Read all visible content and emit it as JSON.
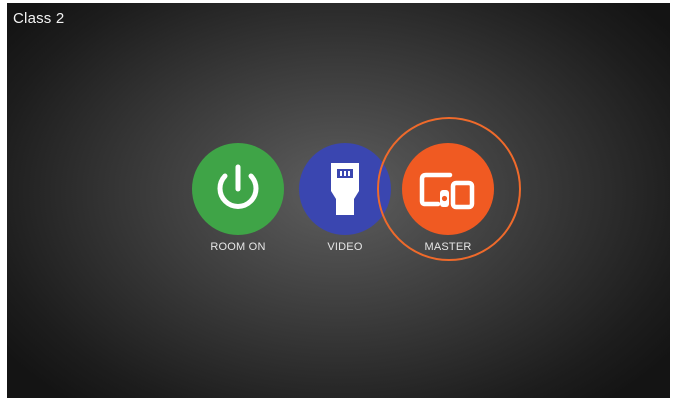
{
  "header": {
    "title": "Class 2"
  },
  "tiles": [
    {
      "label": "ROOM ON",
      "icon": "power-icon",
      "color": "#3fa447"
    },
    {
      "label": "VIDEO",
      "icon": "hdmi-icon",
      "color": "#3a46b0"
    },
    {
      "label": "MASTER",
      "icon": "devices-icon",
      "color": "#f05a22",
      "selected": true
    }
  ],
  "colors": {
    "selection_ring": "#ef6a2b",
    "background": "#3c3c3c",
    "text": "#e6e6e6"
  }
}
